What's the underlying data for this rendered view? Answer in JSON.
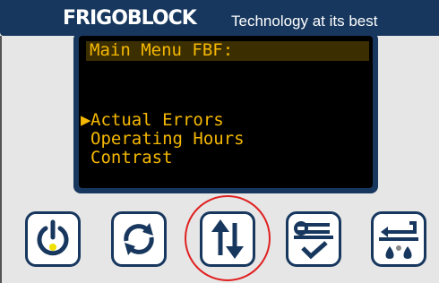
{
  "header": {
    "brand": "FRIGOBLOCK",
    "tagline": "Technology at its best"
  },
  "display": {
    "title": "Main Menu FBF:",
    "cursor": "▶",
    "items": [
      {
        "label": "Actual Errors",
        "selected": true
      },
      {
        "label": "Operating Hours",
        "selected": false
      },
      {
        "label": "Contrast",
        "selected": false
      }
    ]
  },
  "buttons": [
    {
      "name": "power",
      "icon": "power-icon"
    },
    {
      "name": "refresh",
      "icon": "refresh-icon"
    },
    {
      "name": "navigate",
      "icon": "up-down-arrows-icon",
      "highlighted": true
    },
    {
      "name": "settings",
      "icon": "wrench-check-icon"
    },
    {
      "name": "defrost",
      "icon": "defrost-drops-icon"
    }
  ],
  "colors": {
    "brand_navy": "#17375e",
    "display_text": "#f5b800",
    "highlight": "#e02020",
    "power_led": "#f0e000"
  }
}
